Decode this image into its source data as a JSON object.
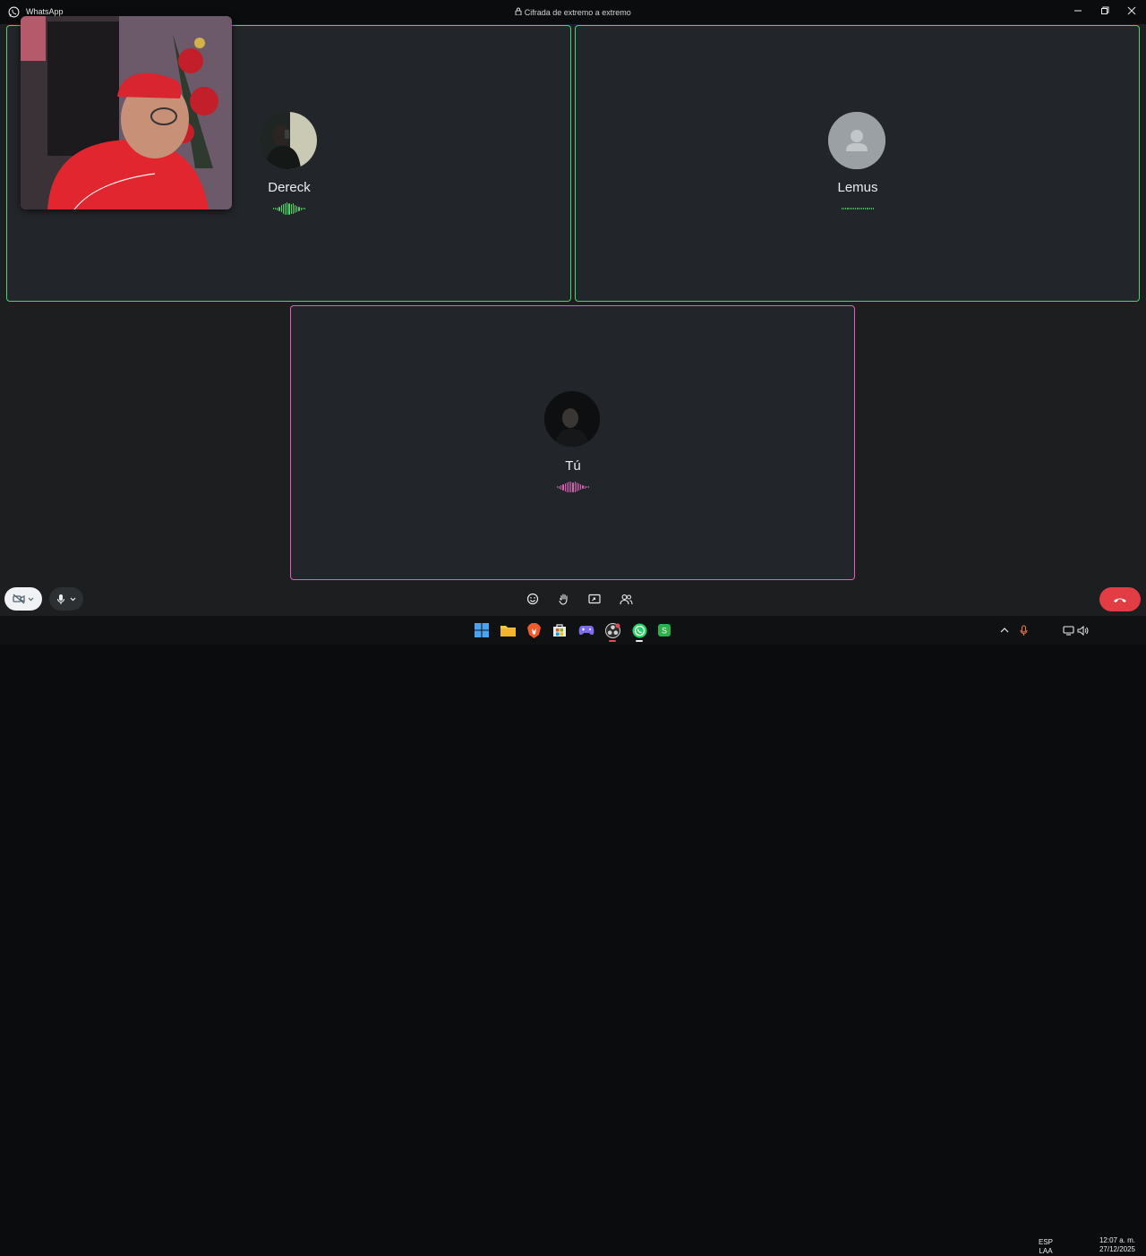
{
  "titlebar": {
    "app_name": "WhatsApp",
    "encryption_text": "Cifrada de extremo a extremo"
  },
  "participants": [
    {
      "name": "Dereck",
      "status": "speaking",
      "color": "#4ad66a"
    },
    {
      "name": "Lemus",
      "status": "silent",
      "color": "#4ad66a"
    },
    {
      "name": "Tú",
      "status": "speaking",
      "color": "#d964b8"
    }
  ],
  "controls": {
    "video_icon": "video-off-icon",
    "mic_icon": "microphone-icon",
    "center_icons": [
      "emoji-icon",
      "raise-hand-icon",
      "share-screen-icon",
      "add-participant-icon"
    ],
    "hangup_icon": "end-call-icon",
    "hangup_color": "#e23c45"
  },
  "taskbar": {
    "apps": [
      "windows-start-icon",
      "file-explorer-icon",
      "brave-browser-icon",
      "microsoft-store-icon",
      "game-controller-icon",
      "obs-icon",
      "whatsapp-icon",
      "app-icon"
    ],
    "language_top": "ESP",
    "language_bottom": "LAA",
    "time": "12:07 a. m.",
    "date": "27/12/2025"
  }
}
